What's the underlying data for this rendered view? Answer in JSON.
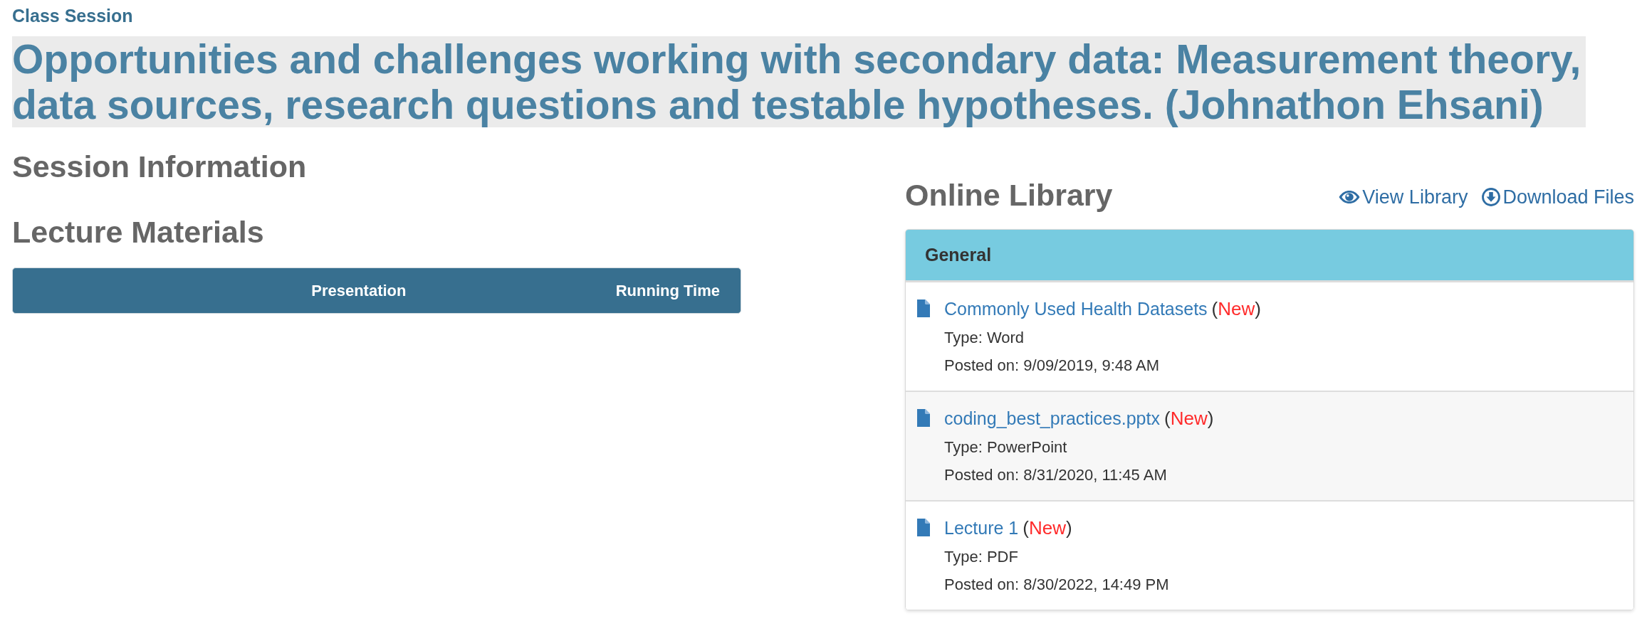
{
  "header": {
    "label": "Class Session",
    "title": "Opportunities and challenges working with secondary data: Measurement theory, data sources, research questions and testable hypotheses. (Johnathon Ehsani)"
  },
  "session_information": {
    "heading": "Session Information"
  },
  "lecture_materials": {
    "heading": "Lecture Materials",
    "table": {
      "columns": [
        "Presentation",
        "Running Time"
      ]
    }
  },
  "online_library": {
    "heading": "Online Library",
    "actions": [
      {
        "kind": "view",
        "label": "View Library"
      },
      {
        "kind": "download",
        "label": "Download Files"
      }
    ],
    "panel": {
      "title": "General",
      "files": [
        {
          "name": "Commonly Used Health Datasets",
          "new_mark": {
            "open": "(",
            "text": "New",
            "close": ")"
          },
          "type": "Type: Word",
          "posted": "Posted on: 9/09/2019, 9:48 AM"
        },
        {
          "name": "coding_best_practices.pptx",
          "new_mark": {
            "open": "(",
            "text": "New",
            "close": ")"
          },
          "type": "Type: PowerPoint",
          "posted": "Posted on: 8/31/2020, 11:45 AM"
        },
        {
          "name": "Lecture 1",
          "new_mark": {
            "open": "(",
            "text": "New",
            "close": ")"
          },
          "type": "Type: PDF",
          "posted": "Posted on: 8/30/2022, 14:49 PM"
        }
      ]
    }
  }
}
